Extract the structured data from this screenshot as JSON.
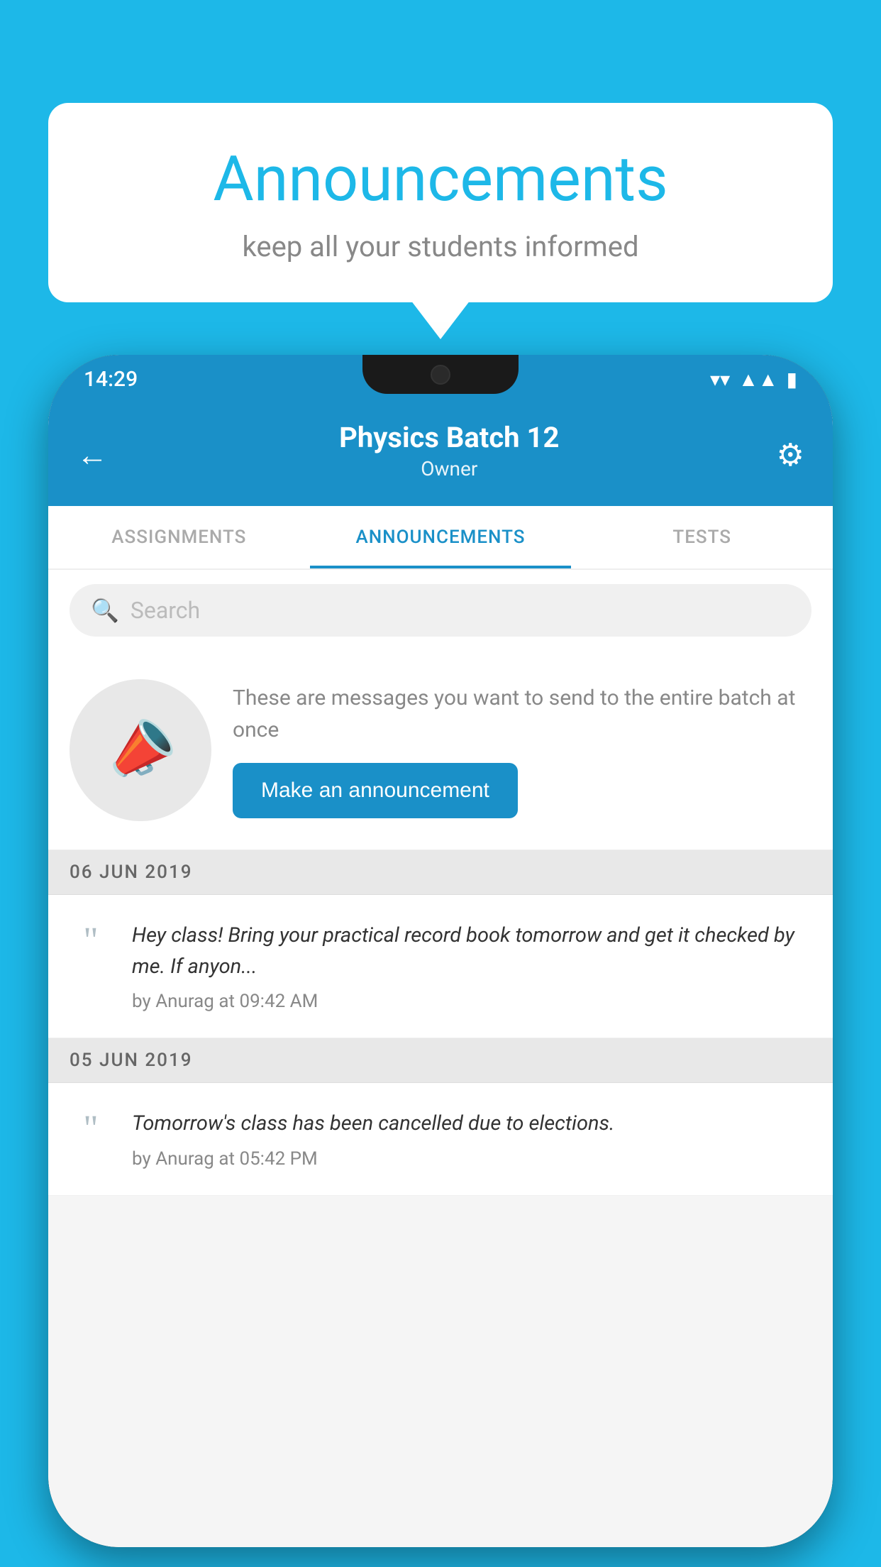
{
  "background": {
    "color": "#1db8e8"
  },
  "speech_bubble": {
    "title": "Announcements",
    "subtitle": "keep all your students informed"
  },
  "phone": {
    "status_bar": {
      "time": "14:29",
      "icons": [
        "wifi",
        "signal",
        "battery"
      ]
    },
    "app_bar": {
      "title": "Physics Batch 12",
      "subtitle": "Owner",
      "back_label": "←",
      "settings_label": "⚙"
    },
    "tabs": [
      {
        "label": "ASSIGNMENTS",
        "active": false
      },
      {
        "label": "ANNOUNCEMENTS",
        "active": true
      },
      {
        "label": "TESTS",
        "active": false
      },
      {
        "label": "...",
        "active": false
      }
    ],
    "search": {
      "placeholder": "Search"
    },
    "promo": {
      "icon": "📣",
      "description": "These are messages you want to send to the entire batch at once",
      "button_label": "Make an announcement"
    },
    "announcements": [
      {
        "date": "06  JUN  2019",
        "message": "Hey class! Bring your practical record book tomorrow and get it checked by me. If anyon...",
        "author": "by Anurag at 09:42 AM"
      },
      {
        "date": "05  JUN  2019",
        "message": "Tomorrow's class has been cancelled due to elections.",
        "author": "by Anurag at 05:42 PM"
      }
    ]
  }
}
